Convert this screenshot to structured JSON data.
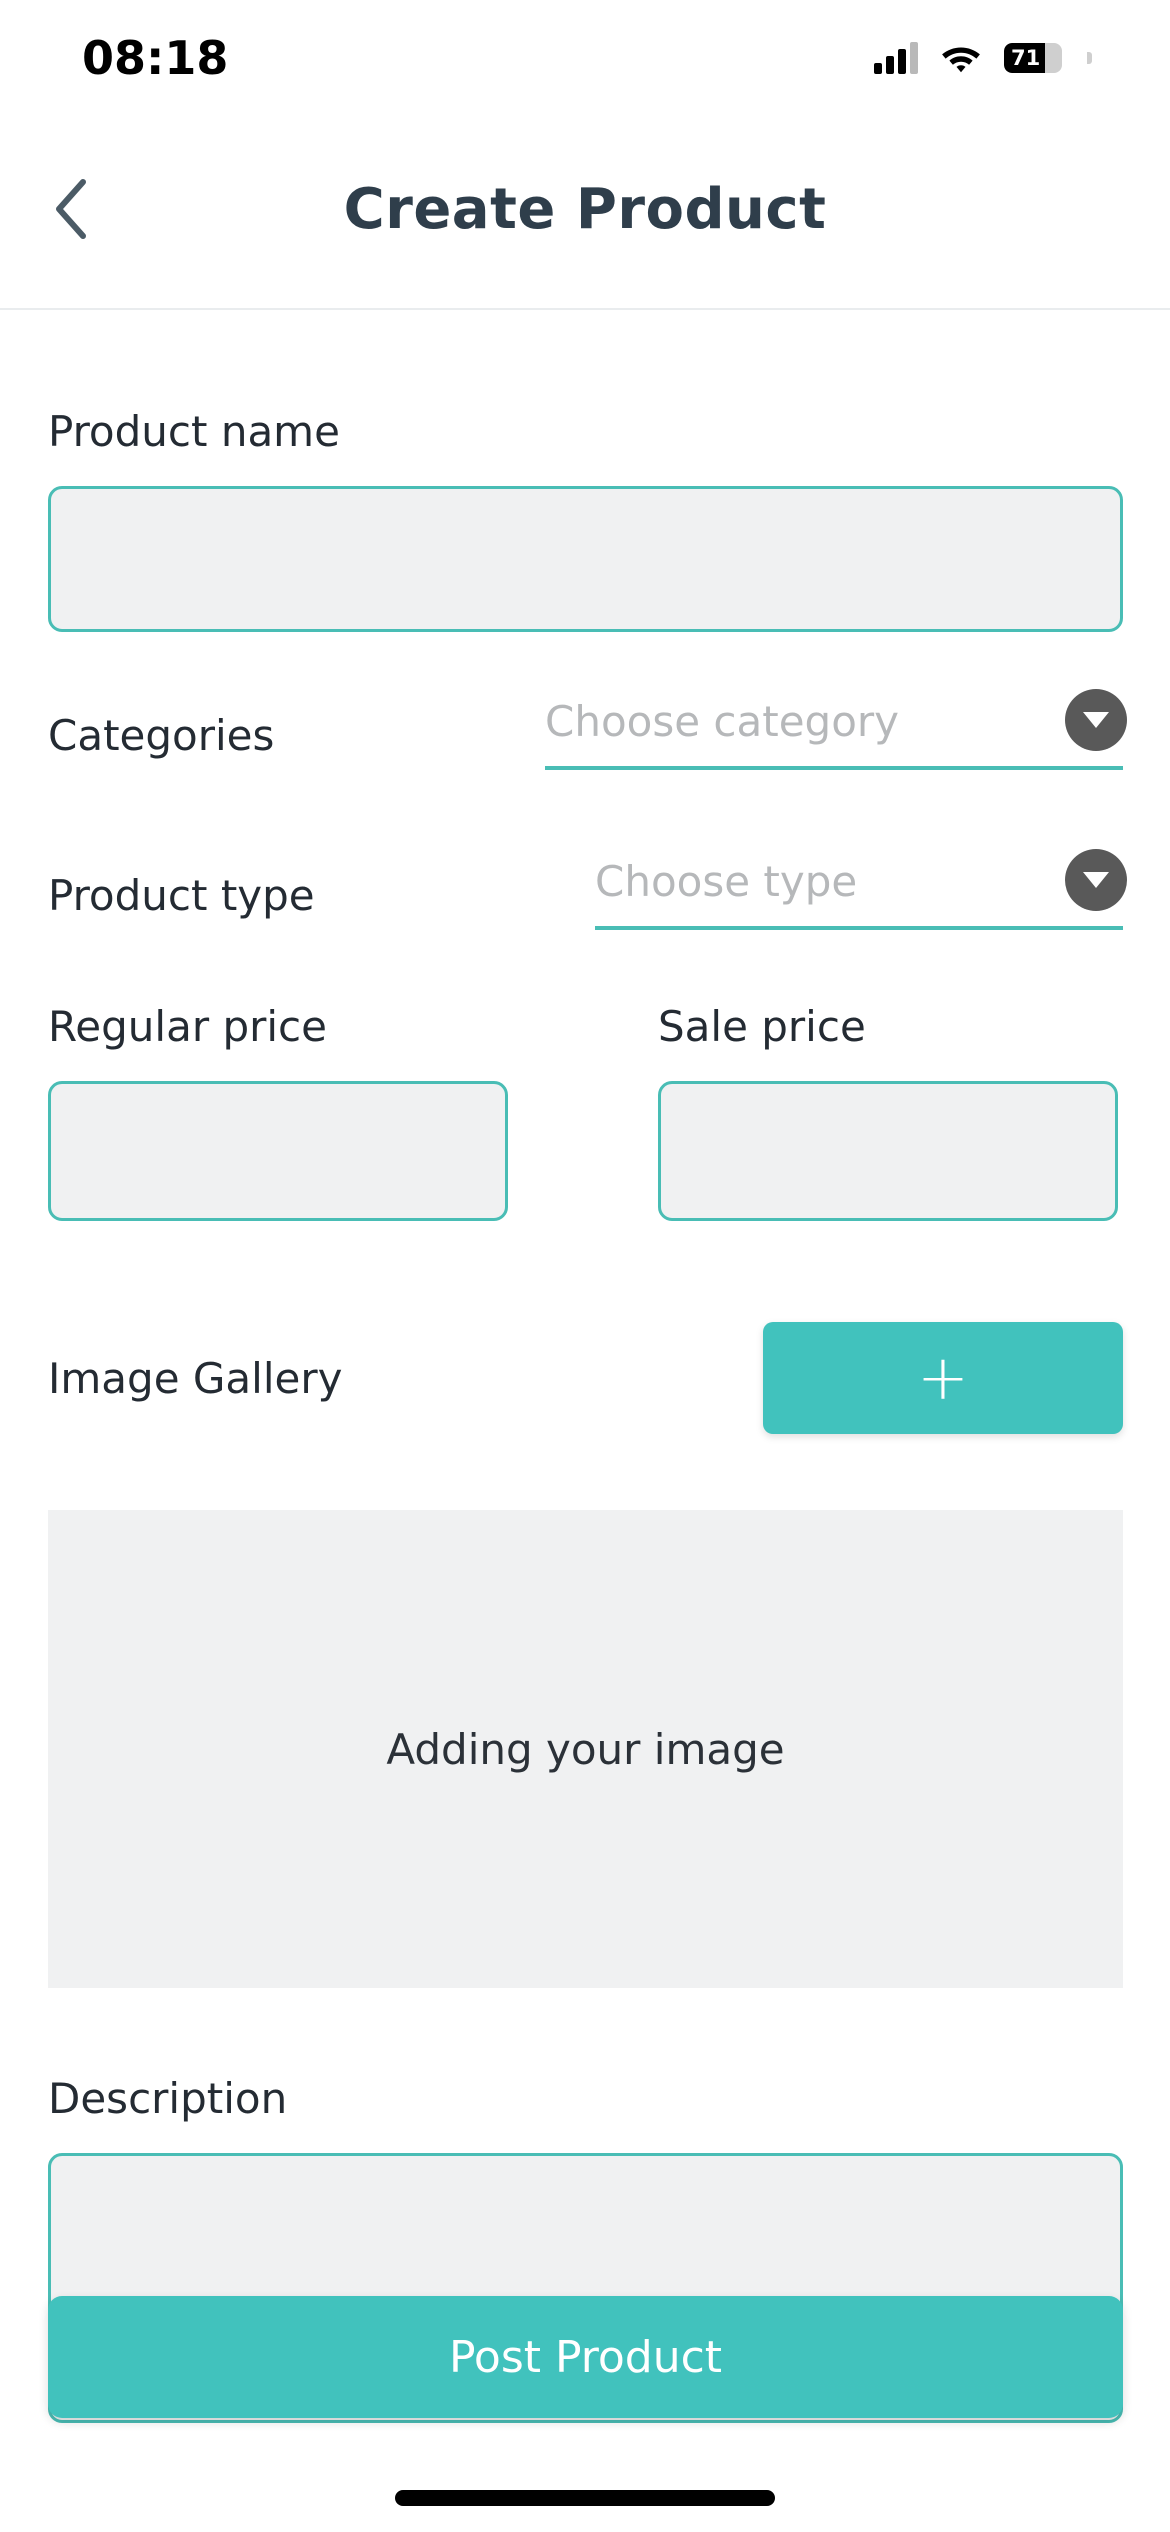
{
  "status_bar": {
    "time": "08:18",
    "battery_percent": "71",
    "signal_icon": "cellular-signal-icon",
    "wifi_icon": "wifi-icon",
    "battery_icon": "battery-icon"
  },
  "header": {
    "back_icon": "chevron-left-icon",
    "title": "Create Product"
  },
  "form": {
    "product_name": {
      "label": "Product name",
      "value": "",
      "placeholder": ""
    },
    "categories": {
      "label": "Categories",
      "placeholder": "Choose category",
      "value": "",
      "caret_icon": "chevron-down-icon"
    },
    "product_type": {
      "label": "Product type",
      "placeholder": "Choose type",
      "value": "",
      "caret_icon": "chevron-down-icon"
    },
    "regular_price": {
      "label": "Regular price",
      "value": "",
      "placeholder": ""
    },
    "sale_price": {
      "label": "Sale price",
      "value": "",
      "placeholder": ""
    },
    "image_gallery": {
      "label": "Image Gallery",
      "add_button_icon": "plus-icon",
      "drop_area_text": "Adding your image"
    },
    "description": {
      "label": "Description",
      "value": "",
      "placeholder": ""
    }
  },
  "footer": {
    "submit_label": "Post Product"
  },
  "colors": {
    "accent_teal": "#41c2bd",
    "border_teal": "#49bdb5",
    "field_fill": "#f0f1f2",
    "title_text": "#2f3e4b",
    "placeholder_text": "#b6b8ba",
    "caret_circle": "#595959"
  }
}
